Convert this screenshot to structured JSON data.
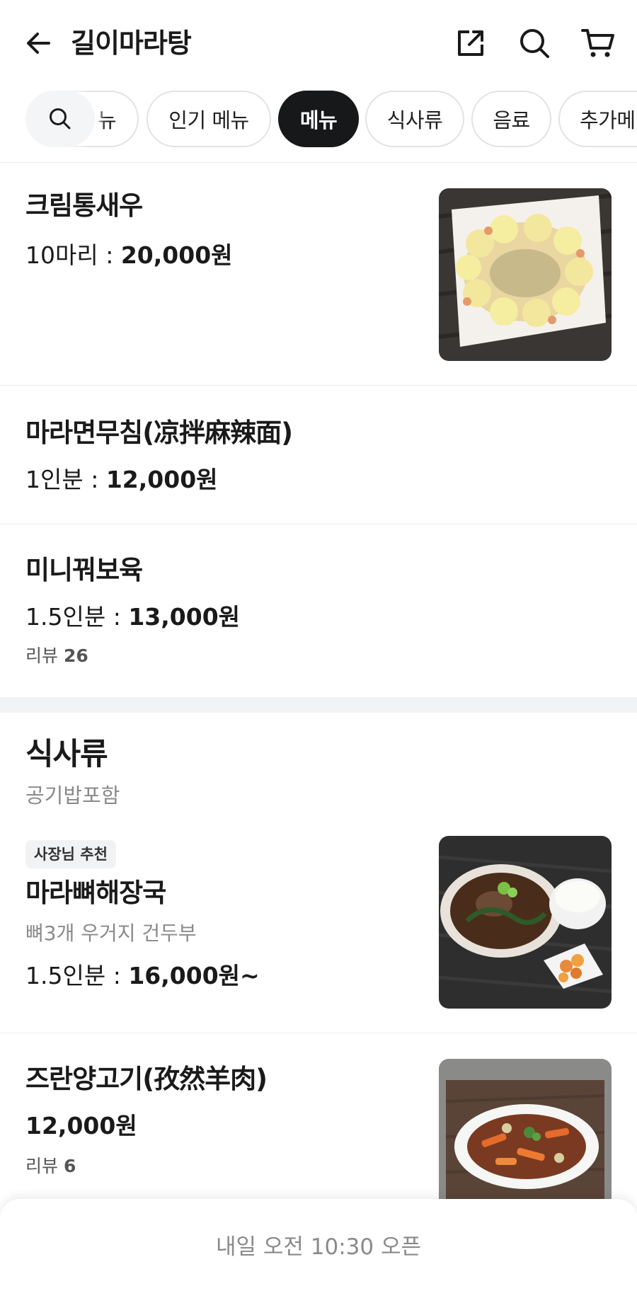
{
  "header": {
    "title": "길이마라탕",
    "icons": [
      "arrow-left-icon",
      "share-icon",
      "search-icon",
      "cart-icon"
    ]
  },
  "categories": {
    "partial_label": "뉴",
    "items": [
      "인기 메뉴",
      "메뉴",
      "식사류",
      "음료",
      "추가메"
    ],
    "active": "메뉴"
  },
  "menu_items": [
    {
      "name": "크림통새우",
      "price_prefix": "10마리 : ",
      "price": "20,000원"
    },
    {
      "name": "마라면무침(凉拌麻辣面)",
      "price_prefix": "1인분 : ",
      "price": "12,000원"
    },
    {
      "name": "미니꿔보육",
      "price_prefix": "1.5인분 : ",
      "price": "13,000원",
      "review_label": "리뷰",
      "review_count": "26"
    }
  ],
  "section": {
    "title": "식사류",
    "subtitle": "공기밥포함"
  },
  "section_items": [
    {
      "badge": "사장님 추천",
      "name": "마라뼈해장국",
      "desc": "뼈3개 우거지 건두부",
      "price_prefix": "1.5인분 : ",
      "price": "16,000원~"
    },
    {
      "name": "즈란양고기(孜然羊肉)",
      "price": "12,000원",
      "review_label": "리뷰",
      "review_count": "6"
    }
  ],
  "bottom_bar": {
    "status": "내일 오전 10:30 오픈"
  },
  "colors": {
    "active_chip": "#17181a",
    "muted_text": "#8a8a8a",
    "divider": "#efefef"
  }
}
